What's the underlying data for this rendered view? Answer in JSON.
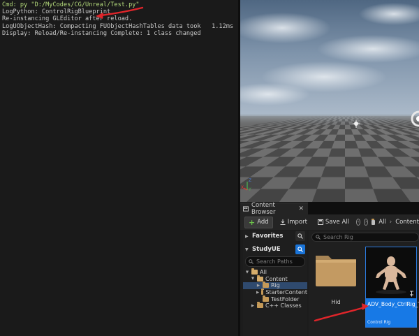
{
  "output_log": {
    "lines": [
      {
        "text": "Cmd: py \"D:/MyCodes/CG/Unreal/Test.py\"",
        "kind": "cmd"
      },
      {
        "text": "LogPython: ControlRigBlueprint",
        "kind": "normal"
      },
      {
        "text": "Re-instancing GLEditor after reload.",
        "kind": "normal"
      },
      {
        "text": "LogUObjectHash: Compacting FUObjectHashTables data took   1.12ms",
        "kind": "normal"
      },
      {
        "text": "Display: Reload/Re-instancing Complete: 1 class changed",
        "kind": "normal"
      }
    ]
  },
  "content_browser": {
    "tab_title": "Content Browser",
    "toolbar": {
      "add_label": "Add",
      "import_label": "Import",
      "save_all_label": "Save All",
      "breadcrumb_all": "All",
      "breadcrumb_sep": "›",
      "breadcrumb_content": "Content"
    },
    "sources": {
      "favorites_label": "Favorites",
      "project_label": "StudyUE",
      "search_paths_placeholder": "Search Paths",
      "tree": [
        {
          "label": "All",
          "depth": 0,
          "expanded": true,
          "folder": "open",
          "selected": false
        },
        {
          "label": "Content",
          "depth": 1,
          "expanded": true,
          "folder": "open",
          "selected": false
        },
        {
          "label": "Rig",
          "depth": 2,
          "expanded": false,
          "folder": "closed",
          "selected": true
        },
        {
          "label": "StarterContent",
          "depth": 2,
          "expanded": false,
          "folder": "closed",
          "selected": false
        },
        {
          "label": "TestFolder",
          "depth": 2,
          "expanded": false,
          "folder": "closed",
          "selected": false,
          "no_toggle": true
        },
        {
          "label": "C++ Classes",
          "depth": 1,
          "expanded": false,
          "folder": "closed",
          "selected": false
        }
      ]
    },
    "assets": {
      "search_placeholder": "Search Rig",
      "folder_tile_label": "Hid",
      "asset_tile_name": "ADV_Body_CtrlRig_Test",
      "asset_tile_type": "Control Rig"
    }
  },
  "colors": {
    "accent_blue": "#1779e6",
    "annotation_arrow": "#e0252a",
    "cmd_green": "#b3d97a"
  }
}
